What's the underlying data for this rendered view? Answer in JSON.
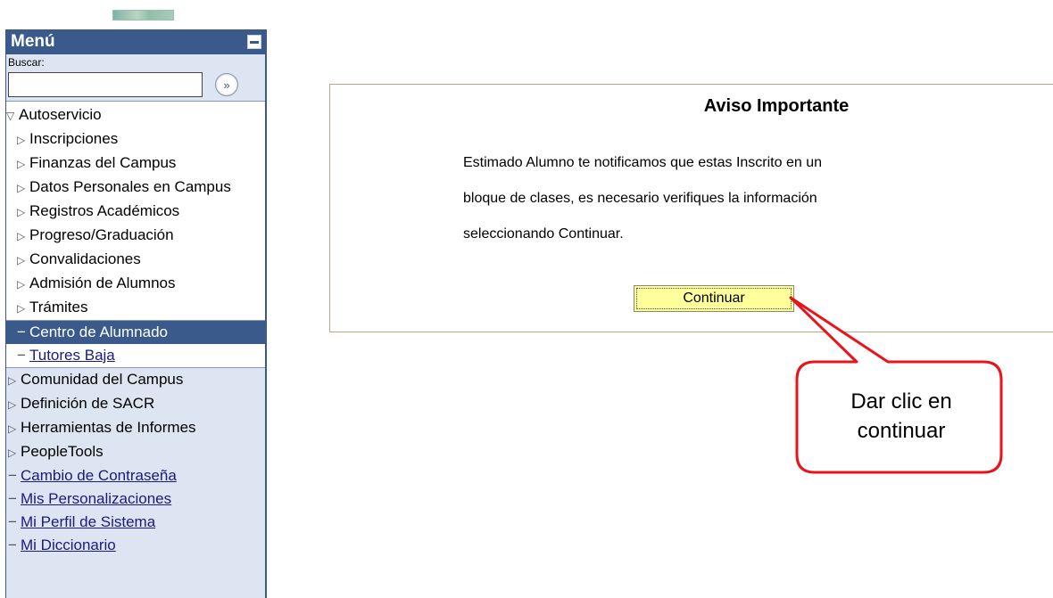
{
  "sidebar": {
    "title": "Menú",
    "search_label": "Buscar:",
    "search_value": "",
    "search_go_glyph": "»",
    "autoservicio": "Autoservicio",
    "autoservicio_items": [
      "Inscripciones",
      "Finanzas del Campus",
      "Datos Personales en Campus",
      "Registros Académicos",
      "Progreso/Graduación",
      "Convalidaciones",
      "Admisión de Alumnos",
      "Trámites"
    ],
    "active_item": "Centro de Alumnado",
    "tutores_item": "Tutores Baja",
    "folders": [
      "Comunidad del Campus",
      "Definición de SACR",
      "Herramientas de Informes",
      "PeopleTools"
    ],
    "links": [
      "Cambio de Contraseña",
      "Mis Personalizaciones",
      "Mi Perfil de Sistema",
      "Mi Diccionario"
    ]
  },
  "notice": {
    "title": "Aviso Importante",
    "lines": [
      "Estimado Alumno te notificamos que estas Inscrito en un",
      "bloque de clases, es necesario verifiques la información",
      "seleccionando Continuar."
    ],
    "button_label": "Continuar"
  },
  "callout": {
    "line1": "Dar clic en",
    "line2": "continuar",
    "color": "#e8141c"
  },
  "colors": {
    "menu_header": "#3a5a8c",
    "sidebar_bg": "#dde5f2",
    "button_bg": "#ffff9c"
  }
}
